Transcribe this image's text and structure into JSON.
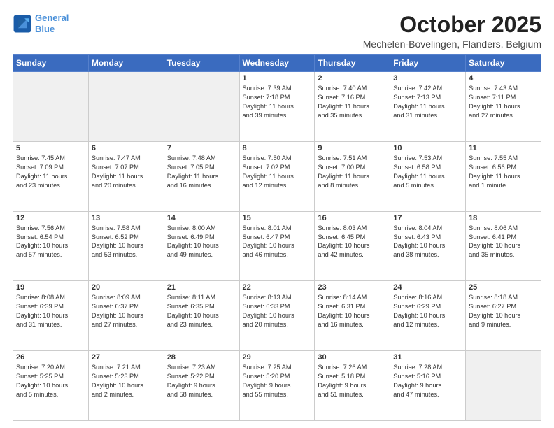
{
  "header": {
    "logo_line1": "General",
    "logo_line2": "Blue",
    "month": "October 2025",
    "location": "Mechelen-Bovelingen, Flanders, Belgium"
  },
  "weekdays": [
    "Sunday",
    "Monday",
    "Tuesday",
    "Wednesday",
    "Thursday",
    "Friday",
    "Saturday"
  ],
  "weeks": [
    [
      {
        "day": "",
        "info": ""
      },
      {
        "day": "",
        "info": ""
      },
      {
        "day": "",
        "info": ""
      },
      {
        "day": "1",
        "info": "Sunrise: 7:39 AM\nSunset: 7:18 PM\nDaylight: 11 hours\nand 39 minutes."
      },
      {
        "day": "2",
        "info": "Sunrise: 7:40 AM\nSunset: 7:16 PM\nDaylight: 11 hours\nand 35 minutes."
      },
      {
        "day": "3",
        "info": "Sunrise: 7:42 AM\nSunset: 7:13 PM\nDaylight: 11 hours\nand 31 minutes."
      },
      {
        "day": "4",
        "info": "Sunrise: 7:43 AM\nSunset: 7:11 PM\nDaylight: 11 hours\nand 27 minutes."
      }
    ],
    [
      {
        "day": "5",
        "info": "Sunrise: 7:45 AM\nSunset: 7:09 PM\nDaylight: 11 hours\nand 23 minutes."
      },
      {
        "day": "6",
        "info": "Sunrise: 7:47 AM\nSunset: 7:07 PM\nDaylight: 11 hours\nand 20 minutes."
      },
      {
        "day": "7",
        "info": "Sunrise: 7:48 AM\nSunset: 7:05 PM\nDaylight: 11 hours\nand 16 minutes."
      },
      {
        "day": "8",
        "info": "Sunrise: 7:50 AM\nSunset: 7:02 PM\nDaylight: 11 hours\nand 12 minutes."
      },
      {
        "day": "9",
        "info": "Sunrise: 7:51 AM\nSunset: 7:00 PM\nDaylight: 11 hours\nand 8 minutes."
      },
      {
        "day": "10",
        "info": "Sunrise: 7:53 AM\nSunset: 6:58 PM\nDaylight: 11 hours\nand 5 minutes."
      },
      {
        "day": "11",
        "info": "Sunrise: 7:55 AM\nSunset: 6:56 PM\nDaylight: 11 hours\nand 1 minute."
      }
    ],
    [
      {
        "day": "12",
        "info": "Sunrise: 7:56 AM\nSunset: 6:54 PM\nDaylight: 10 hours\nand 57 minutes."
      },
      {
        "day": "13",
        "info": "Sunrise: 7:58 AM\nSunset: 6:52 PM\nDaylight: 10 hours\nand 53 minutes."
      },
      {
        "day": "14",
        "info": "Sunrise: 8:00 AM\nSunset: 6:49 PM\nDaylight: 10 hours\nand 49 minutes."
      },
      {
        "day": "15",
        "info": "Sunrise: 8:01 AM\nSunset: 6:47 PM\nDaylight: 10 hours\nand 46 minutes."
      },
      {
        "day": "16",
        "info": "Sunrise: 8:03 AM\nSunset: 6:45 PM\nDaylight: 10 hours\nand 42 minutes."
      },
      {
        "day": "17",
        "info": "Sunrise: 8:04 AM\nSunset: 6:43 PM\nDaylight: 10 hours\nand 38 minutes."
      },
      {
        "day": "18",
        "info": "Sunrise: 8:06 AM\nSunset: 6:41 PM\nDaylight: 10 hours\nand 35 minutes."
      }
    ],
    [
      {
        "day": "19",
        "info": "Sunrise: 8:08 AM\nSunset: 6:39 PM\nDaylight: 10 hours\nand 31 minutes."
      },
      {
        "day": "20",
        "info": "Sunrise: 8:09 AM\nSunset: 6:37 PM\nDaylight: 10 hours\nand 27 minutes."
      },
      {
        "day": "21",
        "info": "Sunrise: 8:11 AM\nSunset: 6:35 PM\nDaylight: 10 hours\nand 23 minutes."
      },
      {
        "day": "22",
        "info": "Sunrise: 8:13 AM\nSunset: 6:33 PM\nDaylight: 10 hours\nand 20 minutes."
      },
      {
        "day": "23",
        "info": "Sunrise: 8:14 AM\nSunset: 6:31 PM\nDaylight: 10 hours\nand 16 minutes."
      },
      {
        "day": "24",
        "info": "Sunrise: 8:16 AM\nSunset: 6:29 PM\nDaylight: 10 hours\nand 12 minutes."
      },
      {
        "day": "25",
        "info": "Sunrise: 8:18 AM\nSunset: 6:27 PM\nDaylight: 10 hours\nand 9 minutes."
      }
    ],
    [
      {
        "day": "26",
        "info": "Sunrise: 7:20 AM\nSunset: 5:25 PM\nDaylight: 10 hours\nand 5 minutes."
      },
      {
        "day": "27",
        "info": "Sunrise: 7:21 AM\nSunset: 5:23 PM\nDaylight: 10 hours\nand 2 minutes."
      },
      {
        "day": "28",
        "info": "Sunrise: 7:23 AM\nSunset: 5:22 PM\nDaylight: 9 hours\nand 58 minutes."
      },
      {
        "day": "29",
        "info": "Sunrise: 7:25 AM\nSunset: 5:20 PM\nDaylight: 9 hours\nand 55 minutes."
      },
      {
        "day": "30",
        "info": "Sunrise: 7:26 AM\nSunset: 5:18 PM\nDaylight: 9 hours\nand 51 minutes."
      },
      {
        "day": "31",
        "info": "Sunrise: 7:28 AM\nSunset: 5:16 PM\nDaylight: 9 hours\nand 47 minutes."
      },
      {
        "day": "",
        "info": ""
      }
    ]
  ]
}
